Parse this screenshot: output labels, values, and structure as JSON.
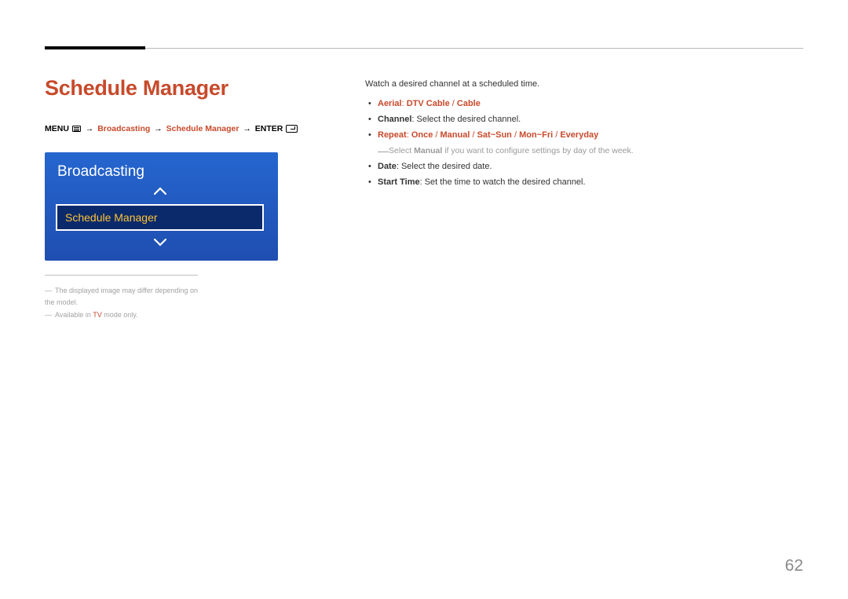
{
  "pageTitle": "Schedule Manager",
  "breadcrumb": {
    "menu": "MENU",
    "path1": "Broadcasting",
    "path2": "Schedule Manager",
    "enter": "ENTER",
    "arrow": "→"
  },
  "osd": {
    "title": "Broadcasting",
    "selected": "Schedule Manager"
  },
  "footnotes": {
    "note1": "The displayed image may differ depending on the model.",
    "note2_pre": "Available in ",
    "note2_hl": "TV",
    "note2_post": " mode only."
  },
  "intro": "Watch a desired channel at a scheduled time.",
  "items": {
    "aerial": {
      "label": "Aerial",
      "colon": ": ",
      "opt1": "DTV Cable",
      "sep": " / ",
      "opt2": "Cable"
    },
    "channel": {
      "label": "Channel",
      "text": ": Select the desired channel."
    },
    "repeat": {
      "label": "Repeat",
      "colon": ": ",
      "opt1": "Once",
      "opt2": "Manual",
      "opt3": "Sat~Sun",
      "opt4": "Mon~Fri",
      "opt5": "Everyday",
      "sep": " / "
    },
    "repeat_sub": {
      "pre": "Select ",
      "bold": "Manual",
      "post": " if you want to configure settings by day of the week."
    },
    "date": {
      "label": "Date",
      "text": ": Select the desired date."
    },
    "start": {
      "label": "Start Time",
      "text": ": Set the time to watch the desired channel."
    }
  },
  "pageNumber": "62"
}
